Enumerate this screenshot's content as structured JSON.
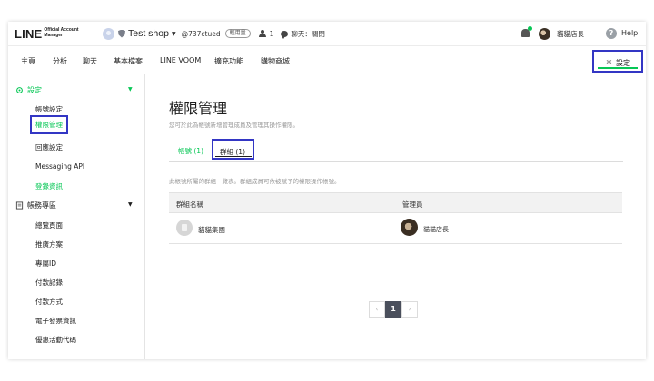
{
  "header": {
    "logo_main": "LINE",
    "logo_sub": "Official Account Manager",
    "account_name": "Test shop",
    "account_id": "@737ctued",
    "plan_badge": "輕用量",
    "member_count": "1",
    "chat_status": "聊天：關閉",
    "user_name": "貓貓店長",
    "help_label": "Help",
    "help_glyph": "?"
  },
  "nav": {
    "items": [
      "主頁",
      "分析",
      "聊天",
      "基本檔案",
      "LINE VOOM",
      "擴充功能",
      "購物商城"
    ],
    "settings_label": "設定"
  },
  "sidebar": {
    "settings_section": "設定",
    "settings_items": [
      "帳號設定",
      "權限管理",
      "回應設定",
      "Messaging API",
      "登錄資訊"
    ],
    "billing_section": "帳務專區",
    "billing_items": [
      "總覽頁面",
      "推廣方案",
      "專屬ID",
      "付款記錄",
      "付款方式",
      "電子發票資訊",
      "優惠活動代碼"
    ]
  },
  "main": {
    "title": "權限管理",
    "description": "您可於此為帳號新增管理成員及管理其操作權限。",
    "tabs": [
      "帳號 (1)",
      "群組 (1)"
    ],
    "list_description": "此帳號所屬的群組一覽表。群組成員可依被賦予的權限操作帳號。",
    "columns": [
      "群組名稱",
      "管理員"
    ],
    "rows": [
      {
        "group": "貓貓集團",
        "manager": "貓貓店長"
      }
    ],
    "pagination": {
      "prev": "‹",
      "current": "1",
      "next": "›"
    }
  },
  "colors": {
    "line_green": "#06c755",
    "highlight_box": "#3336c4"
  }
}
